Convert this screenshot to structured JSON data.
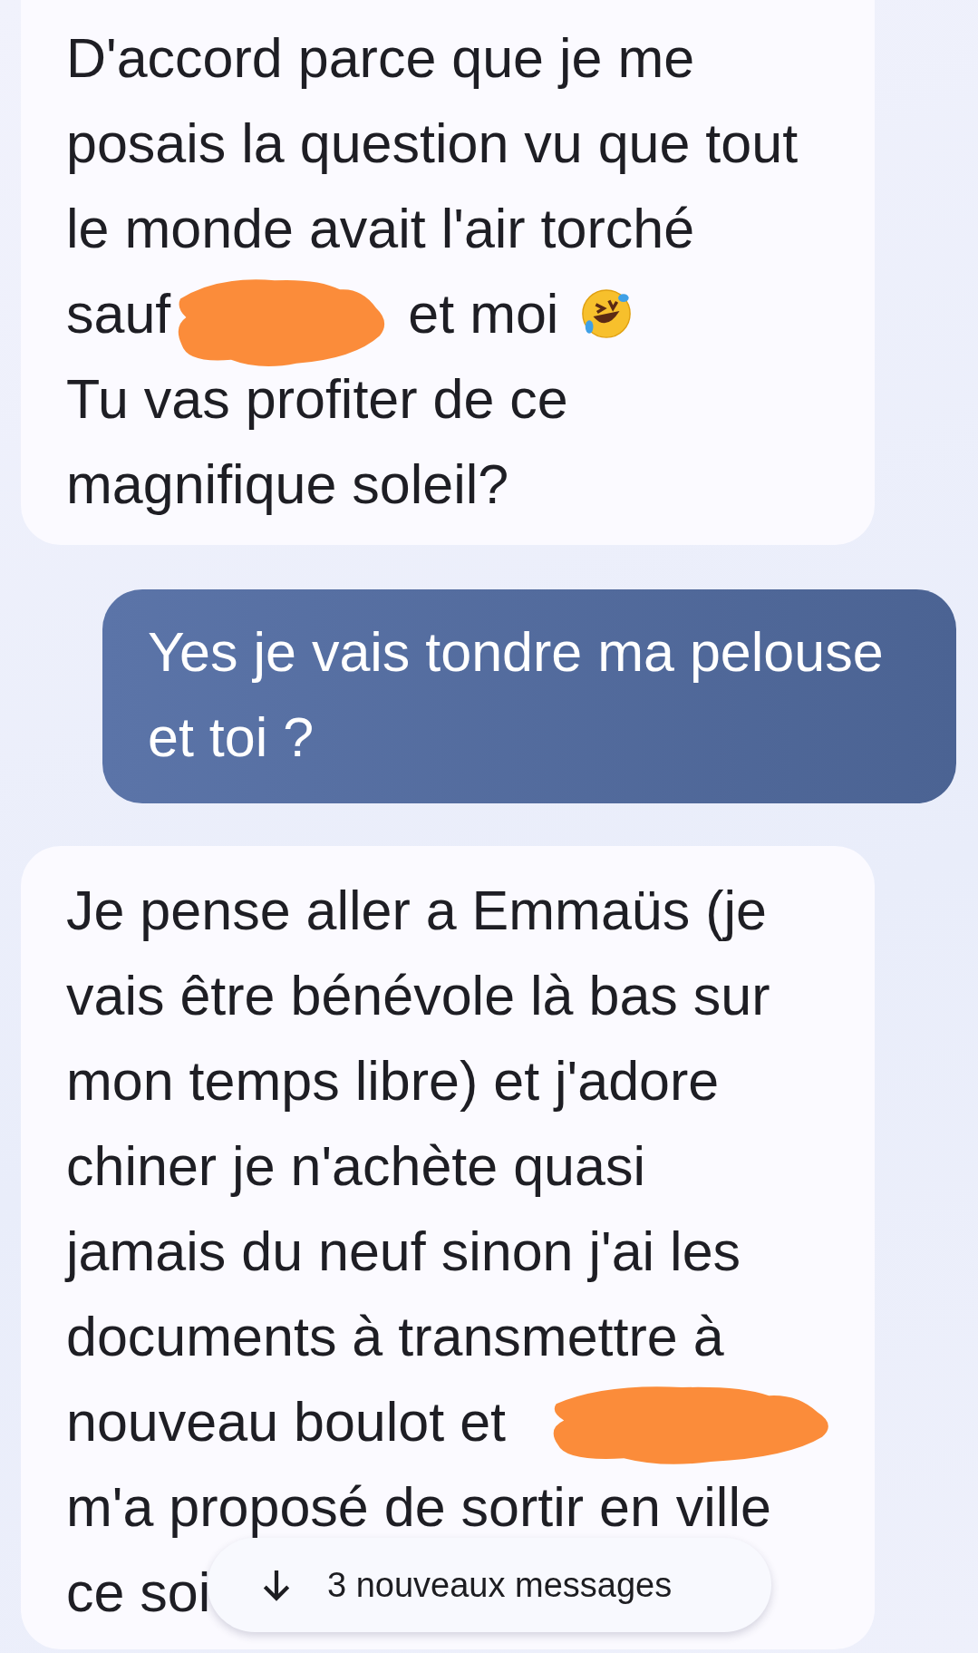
{
  "messages": [
    {
      "kind": "received",
      "lines": [
        {
          "kind": "text",
          "text": "D'accord parce que je me"
        },
        {
          "kind": "text",
          "text": "posais la question vu que tout"
        },
        {
          "kind": "text",
          "text": "le monde avait l'air torché"
        },
        {
          "kind": "redacted",
          "before": "sauf",
          "after": "et moi",
          "emoji": true
        },
        {
          "kind": "text",
          "text": "Tu vas profiter de ce"
        },
        {
          "kind": "text",
          "text": "magnifique soleil?"
        }
      ]
    },
    {
      "kind": "sent",
      "lines": [
        {
          "kind": "text",
          "text": "Yes je vais tondre ma pelouse"
        },
        {
          "kind": "text",
          "text": "et toi ?"
        }
      ]
    },
    {
      "kind": "received",
      "lines": [
        {
          "kind": "text",
          "text": "Je pense aller a Emmaüs (je"
        },
        {
          "kind": "text",
          "text": "vais être bénévole là bas sur"
        },
        {
          "kind": "text",
          "text": "mon temps libre) et j'adore"
        },
        {
          "kind": "text",
          "text": "chiner je n'achète quasi"
        },
        {
          "kind": "text",
          "text": "jamais du neuf sinon j'ai les"
        },
        {
          "kind": "text",
          "text": "documents à transmettre à"
        },
        {
          "kind": "redacted",
          "before": "nouveau boulot et",
          "emoji": false
        },
        {
          "kind": "text",
          "text": "m'a proposé de sortir en ville"
        },
        {
          "kind": "text",
          "text": "ce soi"
        }
      ]
    }
  ],
  "new_messages_pill": {
    "label": "3 nouveaux messages"
  }
}
